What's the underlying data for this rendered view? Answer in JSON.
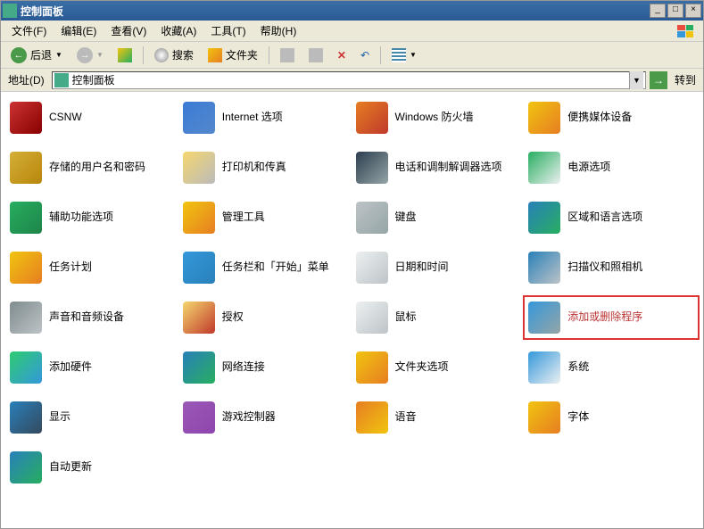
{
  "window": {
    "title": "控制面板",
    "min": "_",
    "max": "□",
    "close": "×"
  },
  "menu": {
    "file": "文件(F)",
    "edit": "编辑(E)",
    "view": "查看(V)",
    "favorites": "收藏(A)",
    "tools": "工具(T)",
    "help": "帮助(H)"
  },
  "toolbar": {
    "back": "后退",
    "search": "搜索",
    "folders": "文件夹"
  },
  "addressbar": {
    "label": "地址(D)",
    "value": "控制面板",
    "go": "转到"
  },
  "items": [
    {
      "id": "csnw",
      "label": "CSNW",
      "icon": "ic-csnw"
    },
    {
      "id": "internet",
      "label": "Internet 选项",
      "icon": "ic-internet"
    },
    {
      "id": "firewall",
      "label": "Windows 防火墙",
      "icon": "ic-firewall"
    },
    {
      "id": "portable",
      "label": "便携媒体设备",
      "icon": "ic-portable"
    },
    {
      "id": "credentials",
      "label": "存储的用户名和密码",
      "icon": "ic-credentials"
    },
    {
      "id": "printer",
      "label": "打印机和传真",
      "icon": "ic-printer"
    },
    {
      "id": "phone",
      "label": "电话和调制解调器选项",
      "icon": "ic-phone"
    },
    {
      "id": "power",
      "label": "电源选项",
      "icon": "ic-power"
    },
    {
      "id": "access",
      "label": "辅助功能选项",
      "icon": "ic-access"
    },
    {
      "id": "admintools",
      "label": "管理工具",
      "icon": "ic-admintools"
    },
    {
      "id": "keyboard",
      "label": "键盘",
      "icon": "ic-keyboard"
    },
    {
      "id": "region",
      "label": "区域和语言选项",
      "icon": "ic-region"
    },
    {
      "id": "tasks",
      "label": "任务计划",
      "icon": "ic-tasks"
    },
    {
      "id": "taskbar",
      "label": "任务栏和「开始」菜单",
      "icon": "ic-taskbar"
    },
    {
      "id": "datetime",
      "label": "日期和时间",
      "icon": "ic-datetime"
    },
    {
      "id": "scanner",
      "label": "扫描仪和照相机",
      "icon": "ic-scanner"
    },
    {
      "id": "sound",
      "label": "声音和音频设备",
      "icon": "ic-sound"
    },
    {
      "id": "license",
      "label": "授权",
      "icon": "ic-license"
    },
    {
      "id": "mouse",
      "label": "鼠标",
      "icon": "ic-mouse"
    },
    {
      "id": "addremove",
      "label": "添加或删除程序",
      "icon": "ic-addremove",
      "highlight": true
    },
    {
      "id": "addhw",
      "label": "添加硬件",
      "icon": "ic-addhw"
    },
    {
      "id": "network",
      "label": "网络连接",
      "icon": "ic-network"
    },
    {
      "id": "folder",
      "label": "文件夹选项",
      "icon": "ic-folder"
    },
    {
      "id": "system",
      "label": "系统",
      "icon": "ic-system"
    },
    {
      "id": "display",
      "label": "显示",
      "icon": "ic-display"
    },
    {
      "id": "gamepad",
      "label": "游戏控制器",
      "icon": "ic-gamepad"
    },
    {
      "id": "speech",
      "label": "语音",
      "icon": "ic-speech"
    },
    {
      "id": "fonts",
      "label": "字体",
      "icon": "ic-fonts"
    },
    {
      "id": "update",
      "label": "自动更新",
      "icon": "ic-update"
    }
  ]
}
